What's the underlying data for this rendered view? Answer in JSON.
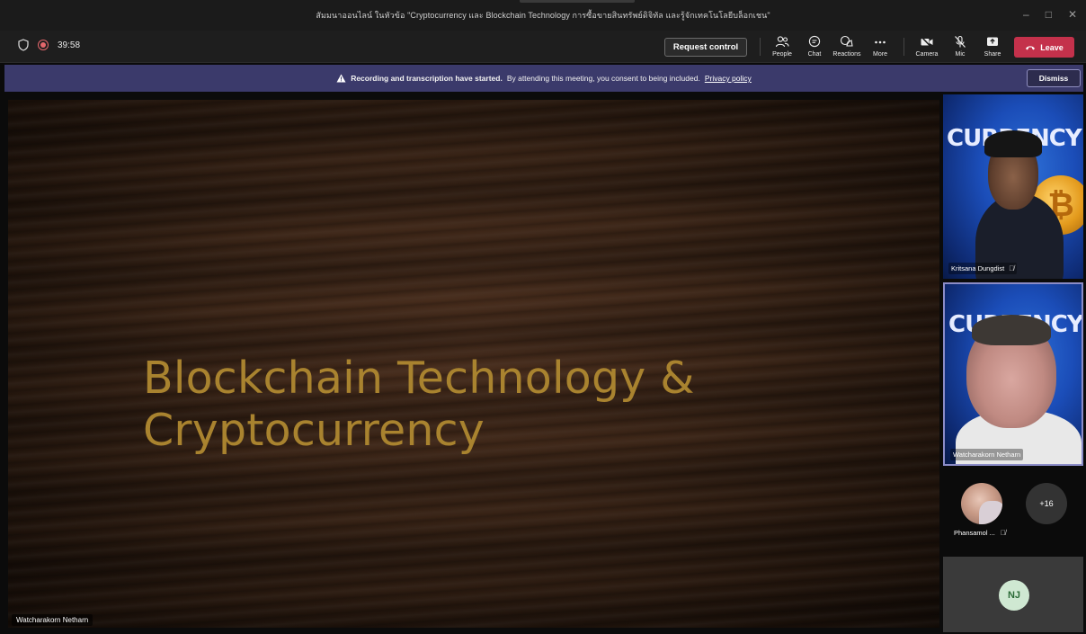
{
  "window": {
    "title": "สัมมนาออนไลน์ ในหัวข้อ \"Cryptocurrency และ Blockchain Technology การซื้อขายสินทรัพย์ดิจิทัล และรู้จักเทคโนโลยีบล็อกเชน\"",
    "minimize": "–",
    "maximize": "□",
    "close": "✕"
  },
  "toolbar": {
    "timer": "39:58",
    "request_control": "Request control",
    "tools": [
      {
        "label": "People",
        "icon": "people-icon"
      },
      {
        "label": "Chat",
        "icon": "chat-icon"
      },
      {
        "label": "Reactions",
        "icon": "reactions-icon"
      },
      {
        "label": "More",
        "icon": "more-icon"
      },
      {
        "label": "Camera",
        "icon": "camera-off-icon"
      },
      {
        "label": "Mic",
        "icon": "mic-off-icon"
      },
      {
        "label": "Share",
        "icon": "share-icon"
      }
    ],
    "leave": "Leave",
    "leave_color": "#c4314b"
  },
  "banner": {
    "bold_text": "Recording and transcription have started.",
    "text": "By attending this meeting, you consent to being included.",
    "link": "Privacy policy",
    "dismiss": "Dismiss",
    "color": "#3b3a6b"
  },
  "stage": {
    "slide_title": "Blockchain Technology &\nCryptocurrency",
    "presenter": "Watcharakorn Netharn"
  },
  "participants": {
    "tile1_name": "Kritsana Dungdist",
    "tile2_name": "Watcharakorn Netharn",
    "roster_name": "Phansamol ...",
    "more_count": "+16",
    "nj_initials": "NJ",
    "tile_backdrop_text": "CURRENCY"
  }
}
